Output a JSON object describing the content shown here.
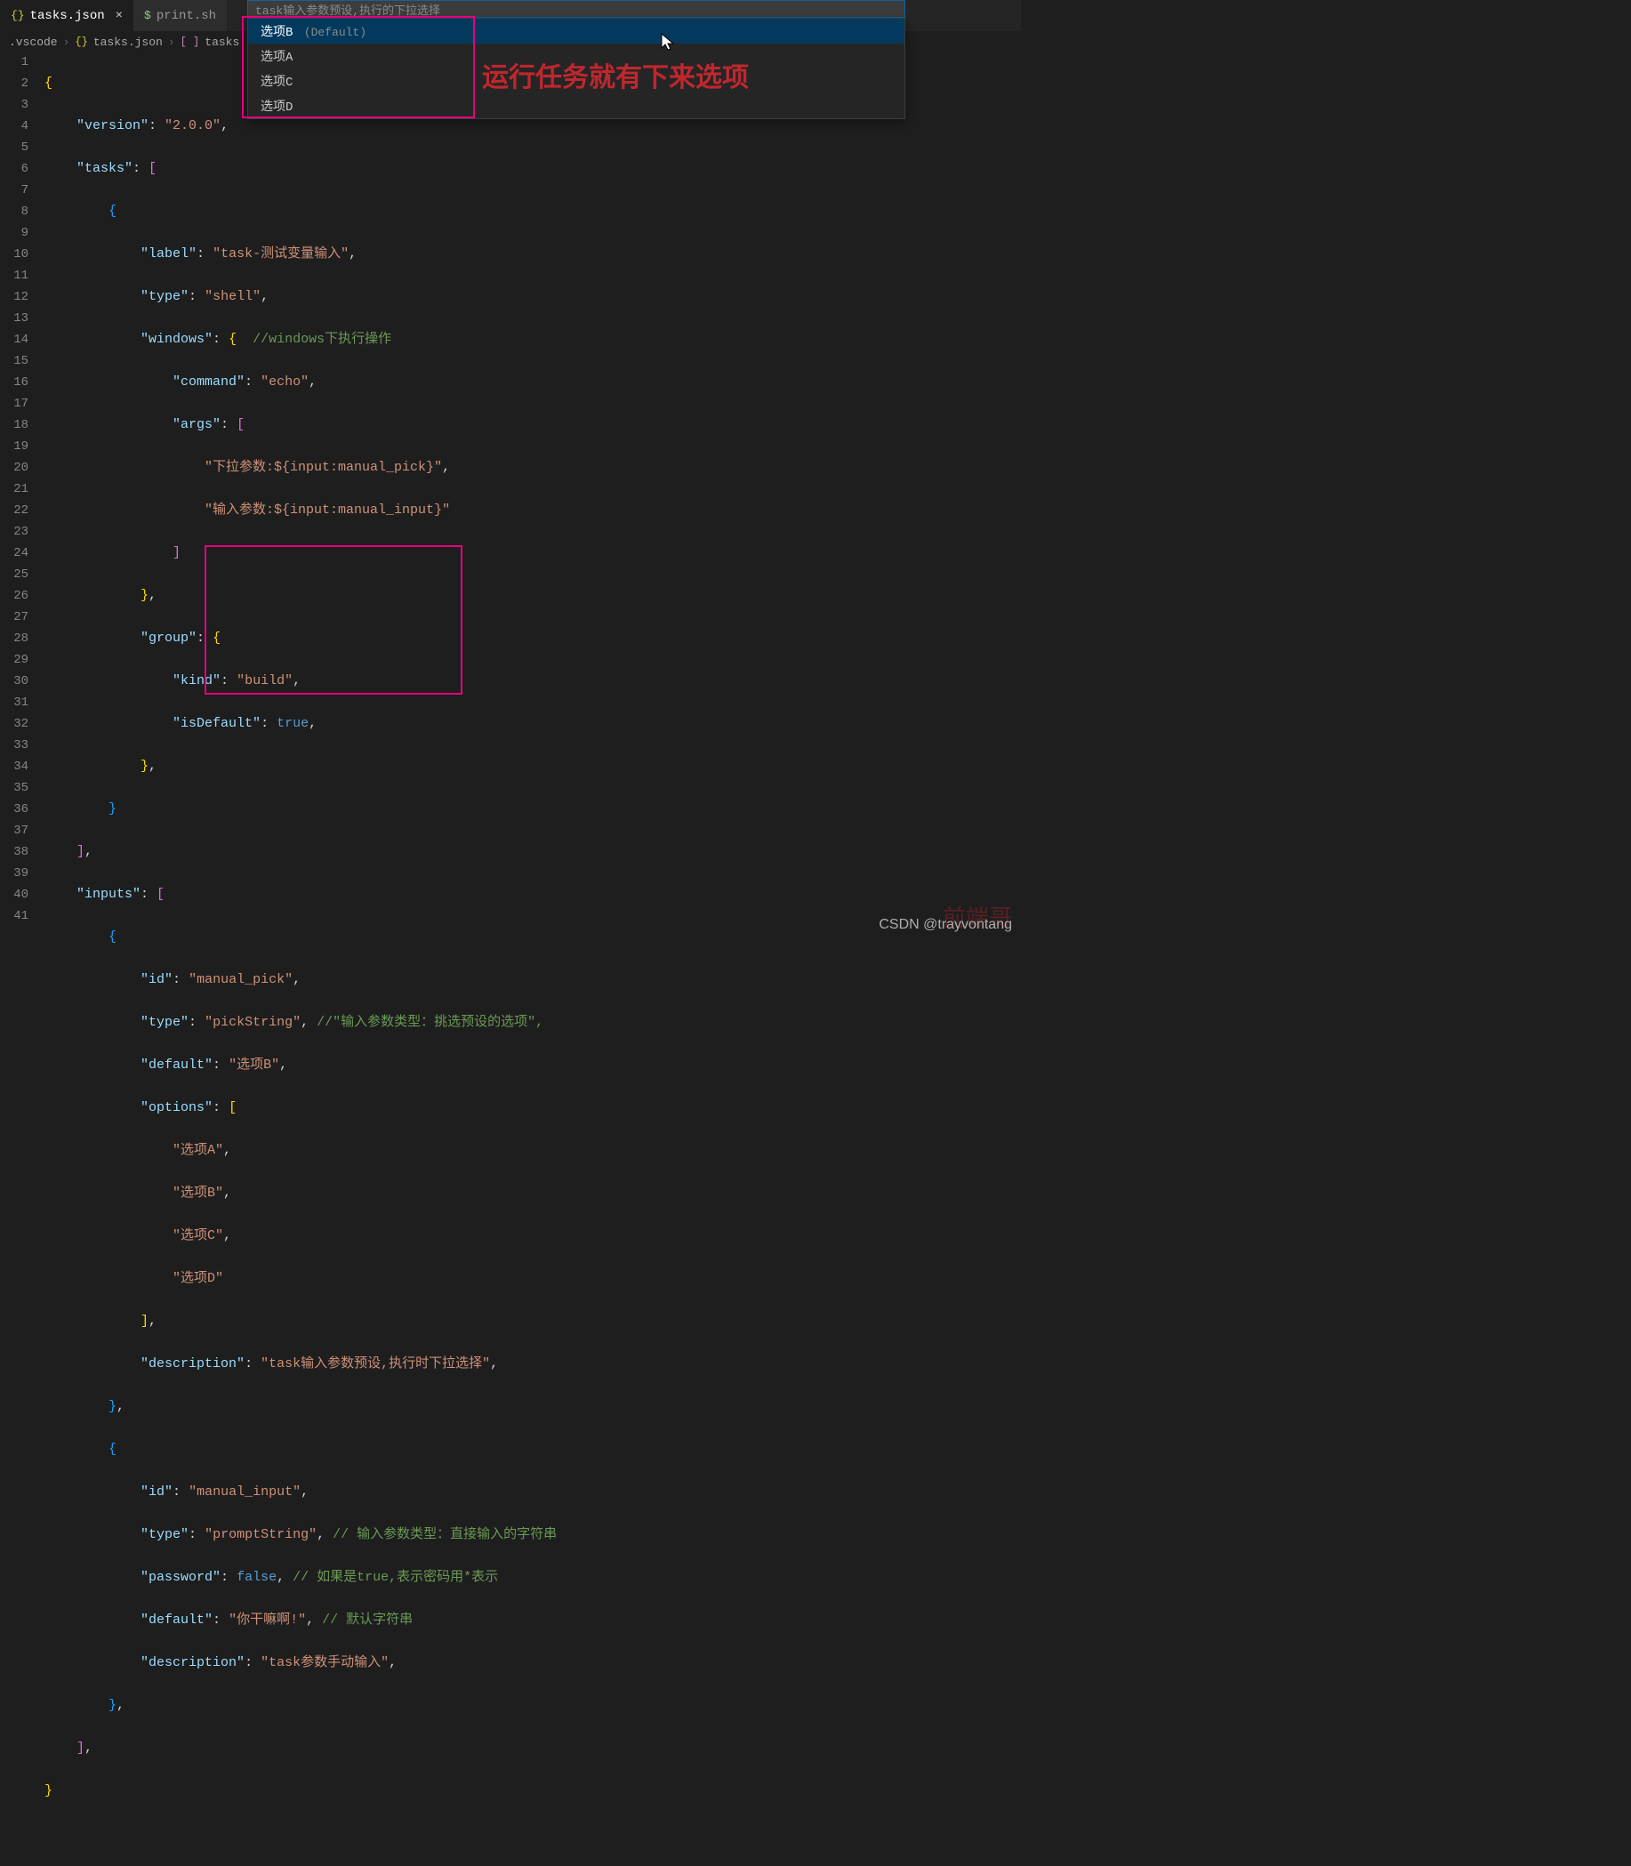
{
  "tabs": [
    {
      "icon": "{}",
      "label": "tasks.json",
      "active": true,
      "closable": true
    },
    {
      "icon": "$",
      "label": "print.sh",
      "active": false,
      "closable": false
    }
  ],
  "breadcrumb": {
    "seg1": ".vscode",
    "seg2": "tasks.json",
    "seg3": "tasks"
  },
  "dropdown": {
    "placeholder": "task输入参数预设,执行的下拉选择",
    "items": [
      {
        "label": "选项B",
        "default_tag": "(Default)",
        "selected": true
      },
      {
        "label": "选项A",
        "selected": false
      },
      {
        "label": "选项C",
        "selected": false
      },
      {
        "label": "选项D",
        "selected": false
      }
    ]
  },
  "annotation": "运行任务就有下来选项",
  "watermark": "CSDN @trayvontang",
  "watermark2": "前端哥",
  "code": {
    "line1": "{",
    "l2_key": "\"version\"",
    "l2_val": "\"2.0.0\"",
    "l3_key": "\"tasks\"",
    "l5_key": "\"label\"",
    "l5_val": "\"task-测试变量输入\"",
    "l6_key": "\"type\"",
    "l6_val": "\"shell\"",
    "l7_key": "\"windows\"",
    "l7_cmt": "//windows下执行操作",
    "l8_key": "\"command\"",
    "l8_val": "\"echo\"",
    "l9_key": "\"args\"",
    "l10_val": "\"下拉参数:${input:manual_pick}\"",
    "l11_val": "\"输入参数:${input:manual_input}\"",
    "l14_key": "\"group\"",
    "l15_key": "\"kind\"",
    "l15_val": "\"build\"",
    "l16_key": "\"isDefault\"",
    "l16_val": "true",
    "l20_key": "\"inputs\"",
    "l22_key": "\"id\"",
    "l22_val": "\"manual_pick\"",
    "l23_key": "\"type\"",
    "l23_val": "\"pickString\"",
    "l23_cmt": "//\"输入参数类型：挑选预设的选项\",",
    "l24_key": "\"default\"",
    "l24_val": "\"选项B\"",
    "l25_key": "\"options\"",
    "l26_val": "\"选项A\"",
    "l27_val": "\"选项B\"",
    "l28_val": "\"选项C\"",
    "l29_val": "\"选项D\"",
    "l31_key": "\"description\"",
    "l31_val": "\"task输入参数预设,执行时下拉选择\"",
    "l34_key": "\"id\"",
    "l34_val": "\"manual_input\"",
    "l35_key": "\"type\"",
    "l35_val": "\"promptString\"",
    "l35_cmt": "// 输入参数类型：直接输入的字符串",
    "l36_key": "\"password\"",
    "l36_val": "false",
    "l36_cmt": "// 如果是true,表示密码用*表示",
    "l37_key": "\"default\"",
    "l37_val": "\"你干嘛啊!\"",
    "l37_cmt": "// 默认字符串",
    "l38_key": "\"description\"",
    "l38_val": "\"task参数手动输入\""
  }
}
